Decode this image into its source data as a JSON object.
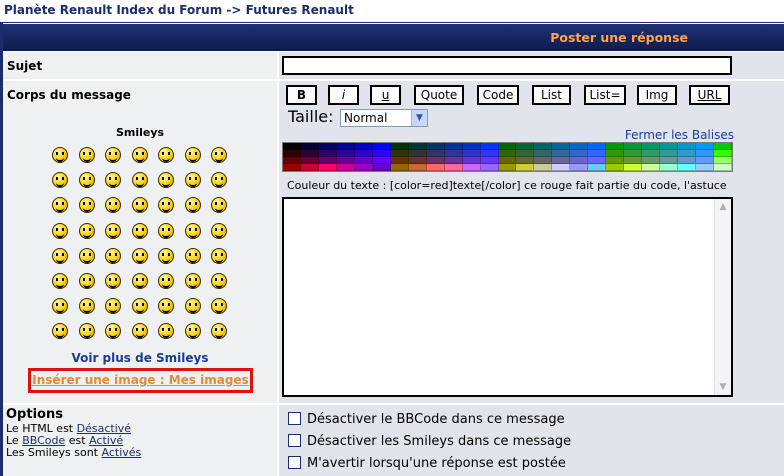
{
  "breadcrumb": {
    "index": "Planète Renault Index du Forum",
    "separator": " -> ",
    "current": "Futures Renault"
  },
  "header": {
    "title": "Poster une réponse"
  },
  "subject": {
    "label": "Sujet",
    "value": ""
  },
  "body": {
    "label": "Corps du message",
    "help_text": "Couleur du texte : [color=red]texte[/color] ce rouge fait partie du code, l'astuce",
    "value": ""
  },
  "toolbar": {
    "buttons": [
      {
        "label": "B"
      },
      {
        "label": "i"
      },
      {
        "label": "u"
      },
      {
        "label": "Quote"
      },
      {
        "label": "Code"
      },
      {
        "label": "List"
      },
      {
        "label": "List="
      },
      {
        "label": "Img"
      },
      {
        "label": "URL"
      }
    ],
    "size_label": "Taille:",
    "size_value": "Normal",
    "close_tags": "Fermer les Balises"
  },
  "palette": {
    "rows": [
      [
        "#000000",
        "#000033",
        "#000066",
        "#000099",
        "#0000cc",
        "#0000ff",
        "#003300",
        "#003333",
        "#003366",
        "#003399",
        "#0033cc",
        "#0033ff",
        "#006600",
        "#006633",
        "#006666",
        "#006699",
        "#0066cc",
        "#0066ff",
        "#009900",
        "#009933",
        "#009966",
        "#009999",
        "#0099cc",
        "#0099ff",
        "#00cc00"
      ],
      [
        "#330000",
        "#330033",
        "#330066",
        "#330099",
        "#3300cc",
        "#3300ff",
        "#333300",
        "#333333",
        "#333366",
        "#333399",
        "#3333cc",
        "#3333ff",
        "#336600",
        "#336633",
        "#336666",
        "#336699",
        "#3366cc",
        "#3366ff",
        "#339900",
        "#339933",
        "#339966",
        "#339999",
        "#3399cc",
        "#3399ff",
        "#33ff00"
      ],
      [
        "#660000",
        "#660033",
        "#660066",
        "#660099",
        "#6600cc",
        "#6600ff",
        "#663300",
        "#663333",
        "#663366",
        "#663399",
        "#6633cc",
        "#6633ff",
        "#666600",
        "#666633",
        "#666666",
        "#666699",
        "#6666cc",
        "#6666ff",
        "#669900",
        "#669933",
        "#669966",
        "#669999",
        "#6699cc",
        "#6699ff",
        "#99ff66"
      ],
      [
        "#990000",
        "#cc0033",
        "#ff0066",
        "#cc0099",
        "#9900cc",
        "#6600cc",
        "#996600",
        "#cc6633",
        "#ff6666",
        "#ff6699",
        "#cc66ff",
        "#9966ff",
        "#999900",
        "#cccc33",
        "#cccc99",
        "#ccccff",
        "#9999ff",
        "#66ccff",
        "#99cc00",
        "#ccff33",
        "#ccff99",
        "#99ffcc",
        "#66ffff",
        "#99ccff",
        "#ccffcc"
      ]
    ]
  },
  "smileys": {
    "title": "Smileys",
    "count": 56,
    "more_link": "Voir plus de Smileys",
    "insert_image": "Insérer une image : Mes images"
  },
  "options": {
    "label": "Options",
    "html_prefix": "Le HTML est ",
    "html_state": "Désactivé",
    "bbcode_prefix": "Le ",
    "bbcode_link": "BBCode",
    "bbcode_mid": " est ",
    "bbcode_state": "Activé",
    "smileys_prefix": "Les Smileys sont ",
    "smileys_state": "Activés",
    "checkboxes": [
      {
        "label": "Désactiver le BBCode dans ce message"
      },
      {
        "label": "Désactiver les Smileys dans ce message"
      },
      {
        "label": "M'avertir lorsqu'une réponse est postée"
      }
    ]
  }
}
